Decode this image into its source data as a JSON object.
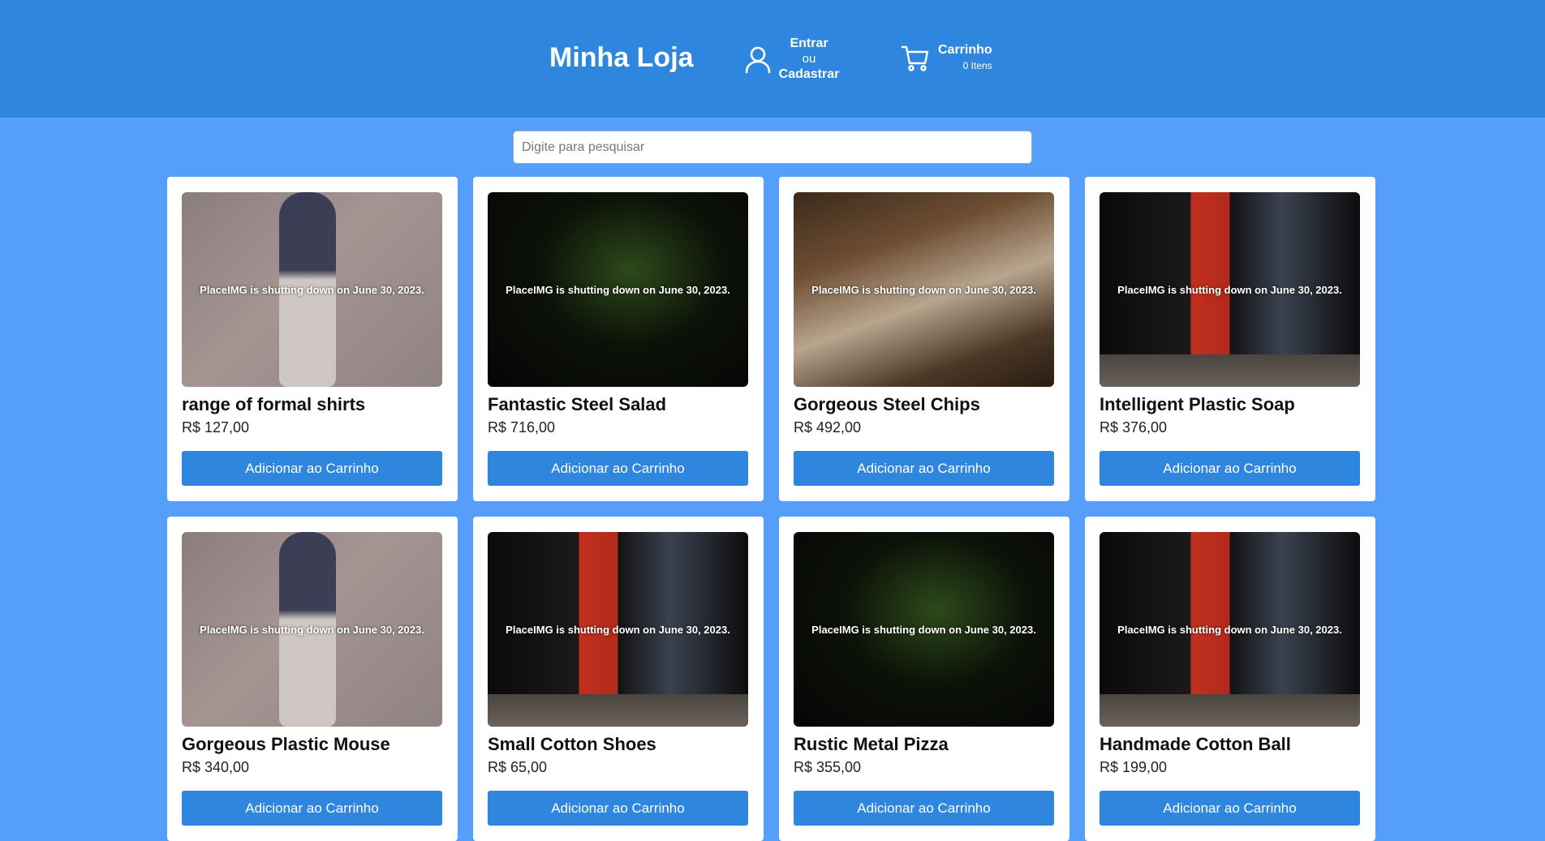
{
  "header": {
    "brand": "Minha Loja",
    "account": {
      "line1": "Entrar",
      "line2": "ou",
      "line3": "Cadastrar"
    },
    "cart": {
      "title": "Carrinho",
      "count": "0 Itens"
    }
  },
  "search": {
    "placeholder": "Digite para pesquisar",
    "value": ""
  },
  "products": [
    {
      "name": "range of formal shirts",
      "price": "R$ 127,00",
      "image_text": "PlaceIMG is shutting down on June 30, 2023.",
      "button": "Adicionar ao Carrinho"
    },
    {
      "name": "Fantastic Steel Salad",
      "price": "R$ 716,00",
      "image_text": "PlaceIMG is shutting down on June 30, 2023.",
      "button": "Adicionar ao Carrinho"
    },
    {
      "name": "Gorgeous Steel Chips",
      "price": "R$ 492,00",
      "image_text": "PlaceIMG is shutting down on June 30, 2023.",
      "button": "Adicionar ao Carrinho"
    },
    {
      "name": "Intelligent Plastic Soap",
      "price": "R$ 376,00",
      "image_text": "PlaceIMG is shutting down on June 30, 2023.",
      "button": "Adicionar ao Carrinho"
    },
    {
      "name": "Gorgeous Plastic Mouse",
      "price": "R$ 340,00",
      "image_text": "PlaceIMG is shutting down on June 30, 2023.",
      "button": "Adicionar ao Carrinho"
    },
    {
      "name": "Small Cotton Shoes",
      "price": "R$ 65,00",
      "image_text": "PlaceIMG is shutting down on June 30, 2023.",
      "button": "Adicionar ao Carrinho"
    },
    {
      "name": "Rustic Metal Pizza",
      "price": "R$ 355,00",
      "image_text": "PlaceIMG is shutting down on June 30, 2023.",
      "button": "Adicionar ao Carrinho"
    },
    {
      "name": "Handmade Cotton Ball",
      "price": "R$ 199,00",
      "image_text": "PlaceIMG is shutting down on June 30, 2023.",
      "button": "Adicionar ao Carrinho"
    }
  ],
  "colors": {
    "header_bg": "#2e86de",
    "page_bg": "#559ffa",
    "button_bg": "#2e86de"
  },
  "icons": {
    "account": "user-icon",
    "cart": "cart-icon"
  }
}
